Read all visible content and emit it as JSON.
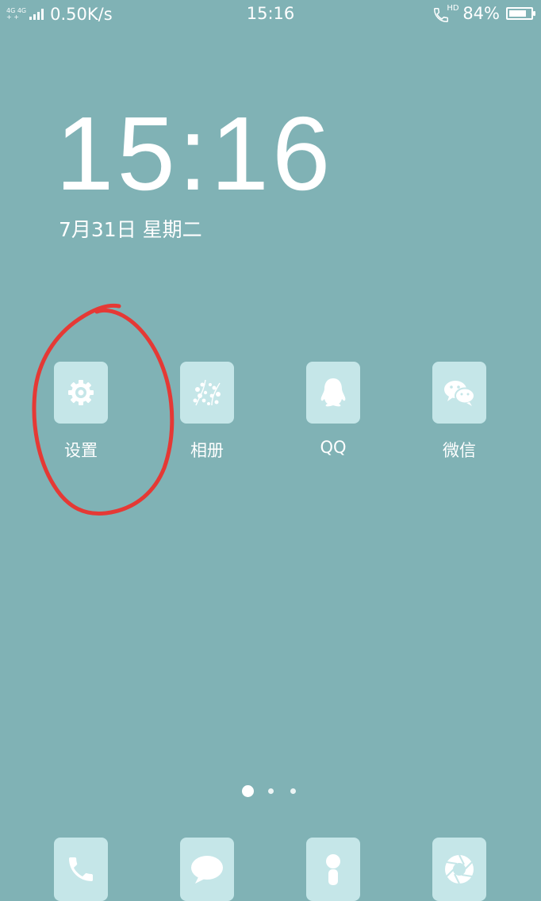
{
  "status_bar": {
    "network_type_top": "4G 4G",
    "network_type_bottom": "+ +",
    "net_speed": "0.50K/s",
    "time": "15:16",
    "hd_label": "HD",
    "battery_percent": "84%",
    "battery_level": 0.84
  },
  "lock_clock": {
    "time": "15:16",
    "date": "7月31日  星期二"
  },
  "apps": [
    {
      "label": "设置",
      "icon": "gear-icon"
    },
    {
      "label": "相册",
      "icon": "photo-album-icon"
    },
    {
      "label": "QQ",
      "icon": "qq-penguin-icon"
    },
    {
      "label": "微信",
      "icon": "wechat-icon"
    }
  ],
  "page_indicator": {
    "count": 3,
    "active": 0
  },
  "dock": [
    {
      "icon": "phone-icon"
    },
    {
      "icon": "message-bubble-icon"
    },
    {
      "icon": "contacts-icon"
    },
    {
      "icon": "camera-shutter-icon"
    }
  ],
  "colors": {
    "background": "#80b2b5",
    "icon_tile": "#c5e6e8",
    "annotation": "#e53935"
  }
}
